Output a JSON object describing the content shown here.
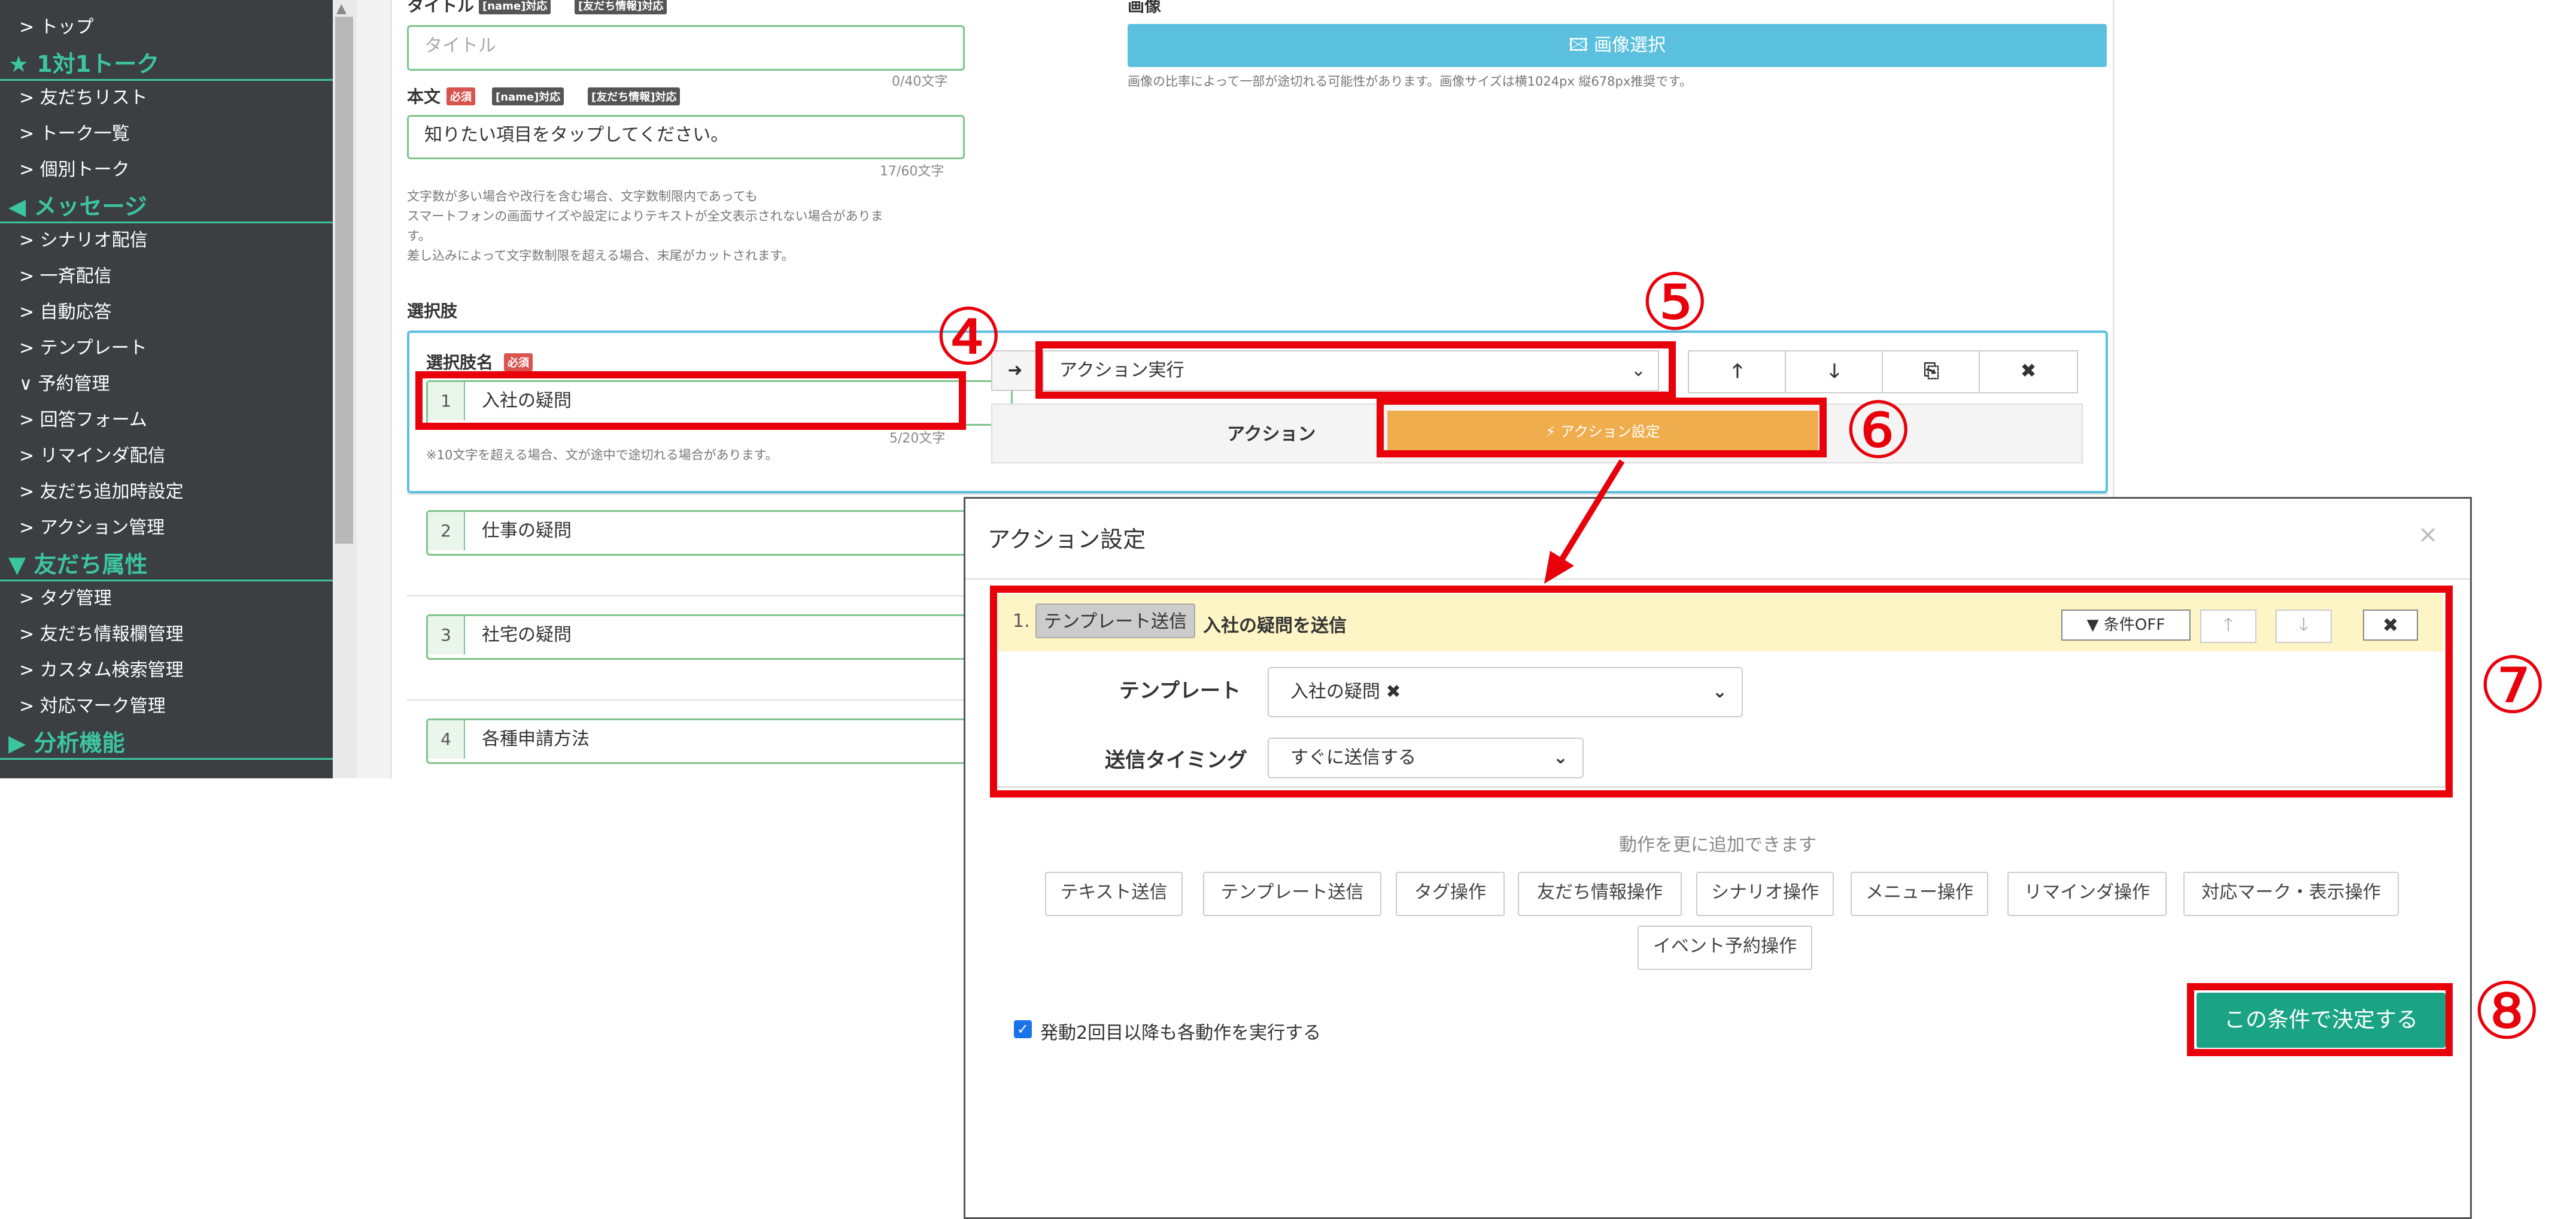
{
  "sidebar": {
    "items": [
      {
        "label": "> トップ",
        "type": "item"
      },
      {
        "label": "★ 1対1トーク",
        "type": "head"
      },
      {
        "label": "> 友だちリスト",
        "type": "item"
      },
      {
        "label": "> トーク一覧",
        "type": "item"
      },
      {
        "label": "> 個別トーク",
        "type": "item"
      },
      {
        "label": "◀ メッセージ",
        "type": "head"
      },
      {
        "label": "> シナリオ配信",
        "type": "item"
      },
      {
        "label": "> 一斉配信",
        "type": "item"
      },
      {
        "label": "> 自動応答",
        "type": "item"
      },
      {
        "label": "> テンプレート",
        "type": "item"
      },
      {
        "label": "∨ 予約管理",
        "type": "item"
      },
      {
        "label": "> 回答フォーム",
        "type": "item"
      },
      {
        "label": "> リマインダ配信",
        "type": "item"
      },
      {
        "label": "> 友だち追加時設定",
        "type": "item"
      },
      {
        "label": "> アクション管理",
        "type": "item"
      },
      {
        "label": "▼ 友だち属性",
        "type": "head"
      },
      {
        "label": "> タグ管理",
        "type": "item"
      },
      {
        "label": "> 友だち情報欄管理",
        "type": "item"
      },
      {
        "label": "> カスタム検索管理",
        "type": "item"
      },
      {
        "label": "> 対応マーク管理",
        "type": "item"
      },
      {
        "label": "▶ 分析機能",
        "type": "head"
      }
    ]
  },
  "form": {
    "title_label": "タイトル",
    "tag_name": "[name]対応",
    "tag_friend": "[友だち情報]対応",
    "title_placeholder": "タイトル",
    "title_count": "0/40文字",
    "body_label": "本文",
    "tag_required": "必須",
    "body_value": "知りたい項目をタップしてください。",
    "body_count": "17/60文字",
    "body_note": [
      "文字数が多い場合や改行を含む場合、文字数制限内であっても",
      "スマートフォンの画面サイズや設定によりテキストが全文表示されない場合がありま",
      "す。",
      "差し込みによって文字数制限を超える場合、末尾がカットされます。"
    ],
    "image_label": "画像",
    "image_button": "🖾 画像選択",
    "image_note": "画像の比率によって一部が途切れる可能性があります。画像サイズは横1024px 縦678px推奨です。",
    "choices_label": "選択肢",
    "choice_name_label": "選択肢名",
    "choice_count": "5/20文字",
    "choice_note": "※10文字を超える場合、文が途中で途切れる場合があります。",
    "choices": [
      {
        "num": "1",
        "label": "入社の疑問"
      },
      {
        "num": "2",
        "label": "仕事の疑問"
      },
      {
        "num": "3",
        "label": "社宅の疑問"
      },
      {
        "num": "4",
        "label": "各種申請方法"
      }
    ],
    "action_type": "アクション実行",
    "arrow": "➜",
    "ctl_up": "🡑",
    "ctl_down": "🡓",
    "ctl_copy": "⎘",
    "ctl_delete": "✖",
    "action_label": "アクション",
    "action_setting_button": "⚡ アクション設定"
  },
  "modal": {
    "title": "アクション設定",
    "close": "×",
    "condition": {
      "num": "1.",
      "tag": "テンプレート送信",
      "title": "入社の疑問を送信",
      "filter_button": "▼ 条件OFF",
      "up": "🡑",
      "down": "🡓",
      "delete": "✖",
      "template_label": "テンプレート",
      "template_value": "入社の疑問 ✖",
      "chevron": "⌄",
      "timing_label": "送信タイミング",
      "timing_value": "すぐに送信する"
    },
    "add_hint": "動作を更に追加できます",
    "action_buttons": [
      "テキスト送信",
      "テンプレート送信",
      "タグ操作",
      "友だち情報操作",
      "シナリオ操作",
      "メニュー操作",
      "リマインダ操作",
      "対応マーク・表示操作",
      "イベント予約操作"
    ],
    "repeat_label": "発動2回目以降も各動作を実行する",
    "decide_button": "この条件で決定する"
  },
  "annotations": {
    "n4": "④",
    "n5": "⑤",
    "n6": "⑥",
    "n7": "⑦",
    "n8": "⑧"
  },
  "colors": {
    "sidebar_bg": "#3b3f42",
    "sidebar_accent": "#3cc6a0",
    "image_button": "#5bc0de",
    "action_setting": "#f0ad4e",
    "decide_button": "#1aa485",
    "annotation": "#e8000b",
    "condition_header": "#fdf5c5"
  }
}
